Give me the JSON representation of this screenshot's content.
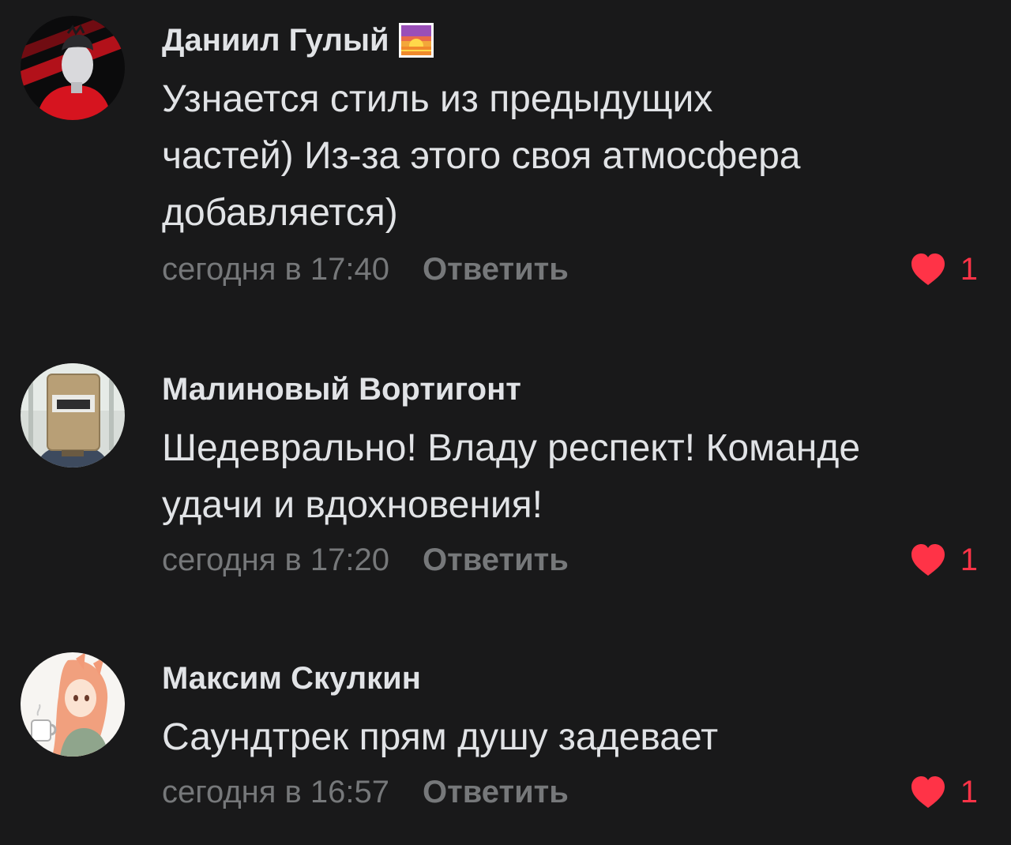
{
  "colors": {
    "background": "#19191a",
    "text": "#e1e3e6",
    "muted": "#76787a",
    "like": "#ff3347"
  },
  "comments": [
    {
      "author": "Даниил Гулый",
      "author_emoji": "sunrise-emoji-icon",
      "avatar_icon": "avatar-red-portrait-icon",
      "lines": [
        "Узнается стиль из предыдущих",
        "частей) Из-за этого своя атмосфера",
        "добавляется)"
      ],
      "time": "сегодня в 17:40",
      "reply_label": "Ответить",
      "likes": "1"
    },
    {
      "author": "Малиновый Вортигонт",
      "avatar_icon": "avatar-welding-mask-icon",
      "lines": [
        "Шедеврально! Владу респект! Команде",
        "удачи и вдохновения!"
      ],
      "time": "сегодня в 17:20",
      "reply_label": "Ответить",
      "likes": "1"
    },
    {
      "author": "Максим Скулкин",
      "avatar_icon": "avatar-anime-girl-icon",
      "lines": [
        "Саундтрек прям душу задевает"
      ],
      "time": "сегодня в 16:57",
      "reply_label": "Ответить",
      "likes": "1"
    }
  ]
}
